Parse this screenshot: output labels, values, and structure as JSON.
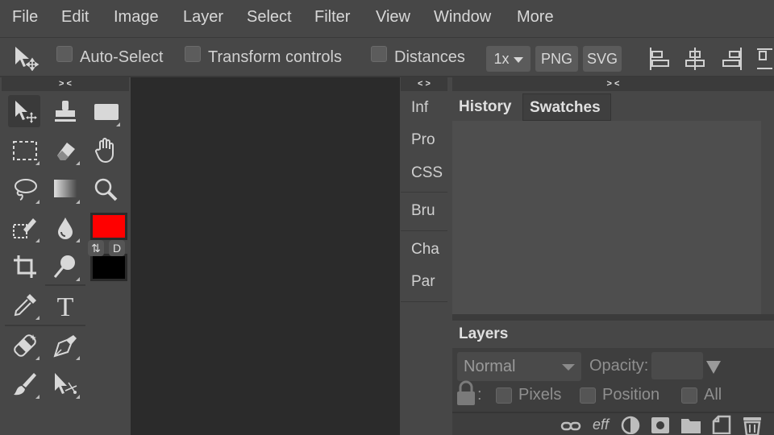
{
  "menu": [
    "File",
    "Edit",
    "Image",
    "Layer",
    "Select",
    "Filter",
    "View",
    "Window",
    "More"
  ],
  "options": {
    "auto_select": "Auto-Select",
    "transform_controls": "Transform controls",
    "distances": "Distances",
    "scale": "1x",
    "png": "PNG",
    "svg": "SVG"
  },
  "strips": {
    "tools": "> <",
    "mini": "< >",
    "right": "> <"
  },
  "tools": {
    "swap": "⇅",
    "default": "D",
    "foreground_color": "#ff0000",
    "background_color": "#000000",
    "icons": [
      "move-icon",
      "stamp-icon",
      "rectangle-icon",
      "marquee-icon",
      "eraser-icon",
      "hand-icon",
      "lasso-icon",
      "gradient-icon",
      "zoom-icon",
      "quick-select-icon",
      "blur-icon",
      "crop-icon",
      "dodge-icon",
      "eyedropper-icon",
      "text-icon",
      "healing-icon",
      "pen-icon",
      "brush-icon",
      "path-select-icon"
    ]
  },
  "mini_panel": [
    "Inf",
    "Pro",
    "CSS",
    "Bru",
    "Cha",
    "Par"
  ],
  "right_panel": {
    "tabs": [
      "History",
      "Swatches"
    ],
    "layers_tab": "Layers",
    "blend_mode": "Normal",
    "opacity_label": "Opacity:",
    "lock_label": ":",
    "lock_pixels": "Pixels",
    "lock_position": "Position",
    "lock_all": "All",
    "footer_eff": "eff"
  }
}
